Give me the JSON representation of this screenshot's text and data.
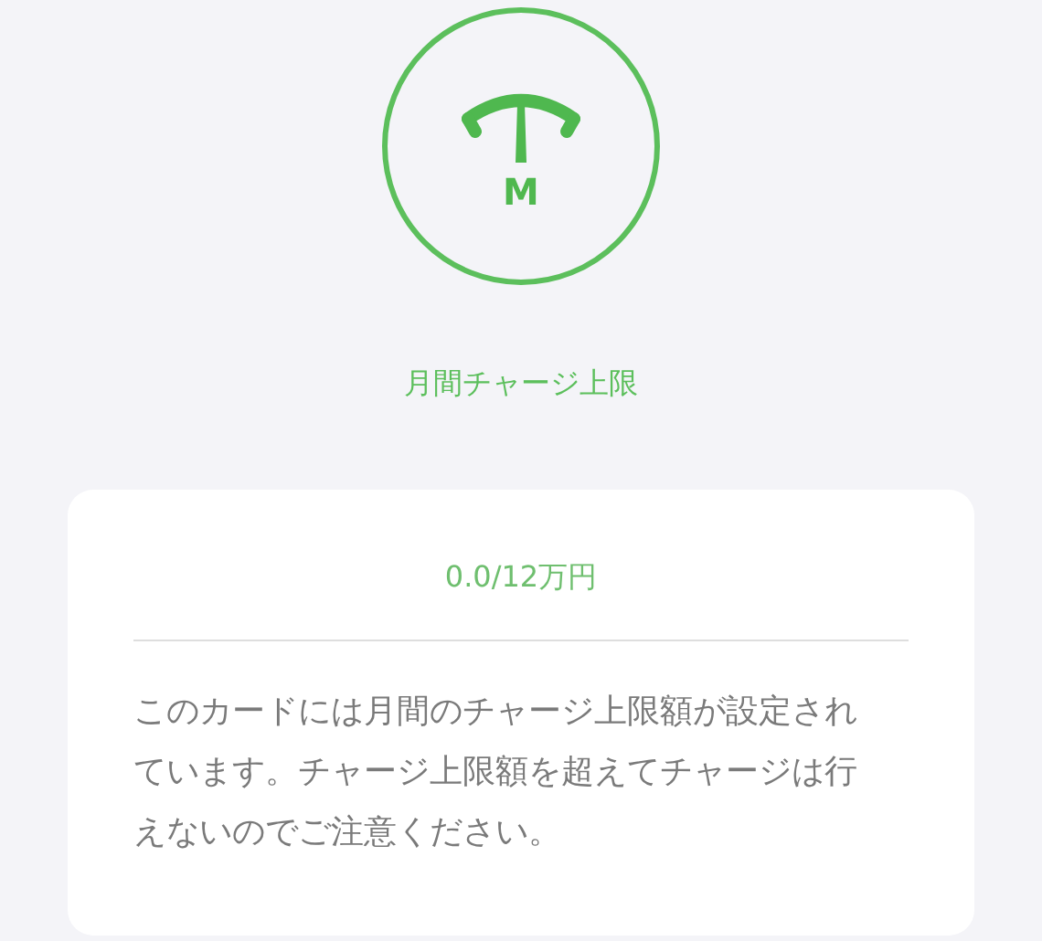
{
  "icon_letter": "M",
  "title": "月間チャージ上限",
  "card": {
    "amount": "0.0/12万円",
    "message": "このカードには月間のチャージ上限額が設定されています。チャージ上限額を超えてチャージは行えないのでご注意ください。"
  }
}
